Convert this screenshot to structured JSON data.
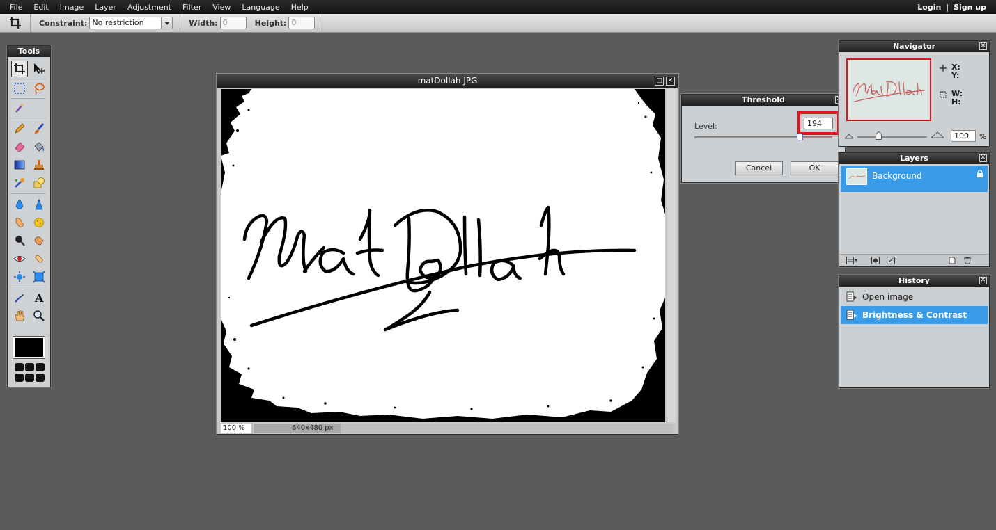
{
  "menubar": {
    "items": [
      "File",
      "Edit",
      "Image",
      "Layer",
      "Adjustment",
      "Filter",
      "View",
      "Language",
      "Help"
    ],
    "login": "Login",
    "separator": "|",
    "signup": "Sign up"
  },
  "options": {
    "constraint_label": "Constraint:",
    "constraint_value": "No restriction",
    "width_label": "Width:",
    "width_value": "0",
    "height_label": "Height:",
    "height_value": "0"
  },
  "tools": {
    "title": "Tools",
    "foreground_color": "#000000"
  },
  "image_window": {
    "title": "matDollah.JPG",
    "zoom": "100 %",
    "dimensions": "640x480 px"
  },
  "threshold": {
    "title": "Threshold",
    "level_label": "Level:",
    "level_value": "194",
    "level_fraction": 0.761,
    "cancel_label": "Cancel",
    "ok_label": "OK",
    "highlight_color": "#e0151f"
  },
  "navigator": {
    "title": "Navigator",
    "x_label": "X:",
    "y_label": "Y:",
    "w_label": "W:",
    "h_label": "H:",
    "zoom_value": "100",
    "zoom_unit": "%"
  },
  "layers": {
    "title": "Layers",
    "items": [
      {
        "name": "Background",
        "locked": true
      }
    ]
  },
  "history": {
    "title": "History",
    "items": [
      "Open image",
      "Brightness & Contrast"
    ],
    "selected_index": 1
  },
  "colors": {
    "selection": "#3a9be8",
    "panel_bg": "#cdd0d3",
    "workspace": "#5a5a5a"
  }
}
